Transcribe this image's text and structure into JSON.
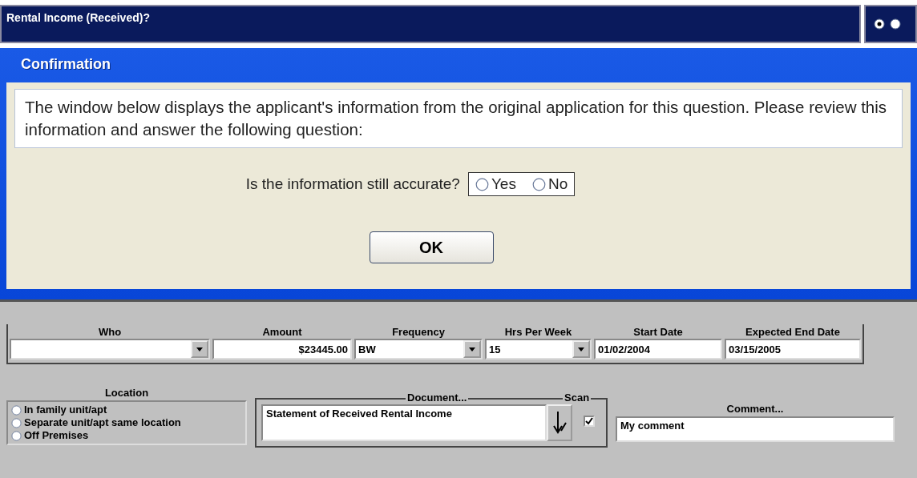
{
  "header": {
    "title": "Rental Income (Received)?",
    "options": [
      {
        "selected": true
      },
      {
        "selected": false
      }
    ]
  },
  "dialog": {
    "title": "Confirmation",
    "message": "The window below displays the applicant's information from the original application for this question. Please review this information and answer the following question:",
    "question": "Is the information still accurate?",
    "answers": [
      {
        "label": "Yes",
        "selected": false
      },
      {
        "label": "No",
        "selected": false
      }
    ],
    "ok_button": "OK"
  },
  "form": {
    "fields": [
      {
        "label": "Who",
        "kind": "dropdown"
      },
      {
        "label": "Amount",
        "kind": "amount",
        "value": "$23445.00"
      },
      {
        "label": "Frequency",
        "kind": "dropdown",
        "value": "BW"
      },
      {
        "label": "Hrs Per Week",
        "kind": "dropdown",
        "value": "15"
      },
      {
        "label": "Start Date",
        "kind": "text",
        "value": "01/02/2004"
      },
      {
        "label": "Expected End Date",
        "kind": "text",
        "value": "03/15/2005"
      }
    ],
    "location": {
      "label": "Location",
      "options": [
        {
          "label": "In family unit/apt",
          "selected": false
        },
        {
          "label": "Separate unit/apt same location",
          "selected": false
        },
        {
          "label": "Off Premises",
          "selected": false
        }
      ]
    },
    "document": {
      "label": "Document...",
      "value": "Statement of Received Rental Income"
    },
    "scan": {
      "label": "Scan",
      "checked": true
    },
    "comment": {
      "label": "Comment...",
      "value": "My comment"
    }
  }
}
